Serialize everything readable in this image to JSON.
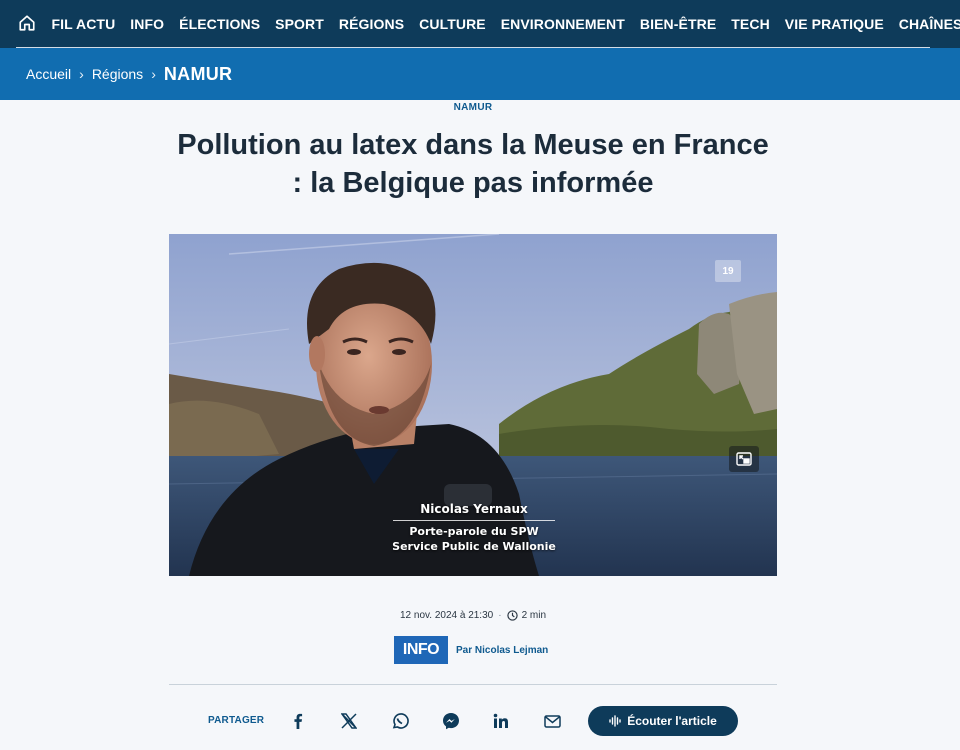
{
  "nav": {
    "home_icon": "home-icon",
    "items": [
      "FIL ACTU",
      "INFO",
      "ÉLECTIONS",
      "SPORT",
      "RÉGIONS",
      "CULTURE",
      "ENVIRONNEMENT",
      "BIEN-ÊTRE",
      "TECH",
      "VIE PRATIQUE",
      "CHAÎNES"
    ]
  },
  "breadcrumb": {
    "items": [
      "Accueil",
      "Régions"
    ],
    "current": "NAMUR",
    "separator": "›"
  },
  "article": {
    "kicker": "NAMUR",
    "title": "Pollution au latex dans la Meuse en France : la Belgique pas informée",
    "video": {
      "caption_name": "Nicolas Yernaux",
      "caption_role_1": "Porte-parole du SPW",
      "caption_role_2": "Service Public de Wallonie",
      "channel_logo": "19",
      "pip_icon": "picture-in-picture-icon"
    },
    "date": "12 nov. 2024 à 21:30",
    "read_time": "2 min",
    "section_badge": "INFO",
    "author": "Par Nicolas Lejman"
  },
  "share": {
    "label": "PARTAGER",
    "icons": [
      "facebook-icon",
      "x-icon",
      "whatsapp-icon",
      "messenger-icon",
      "linkedin-icon",
      "mail-icon"
    ],
    "listen_label": "Écouter l'article"
  },
  "colors": {
    "nav_bg": "#0e3b5a",
    "breadcrumb_bg": "#116db0",
    "badge_bg": "#1f67b7",
    "accent_text": "#0f5a8f"
  }
}
